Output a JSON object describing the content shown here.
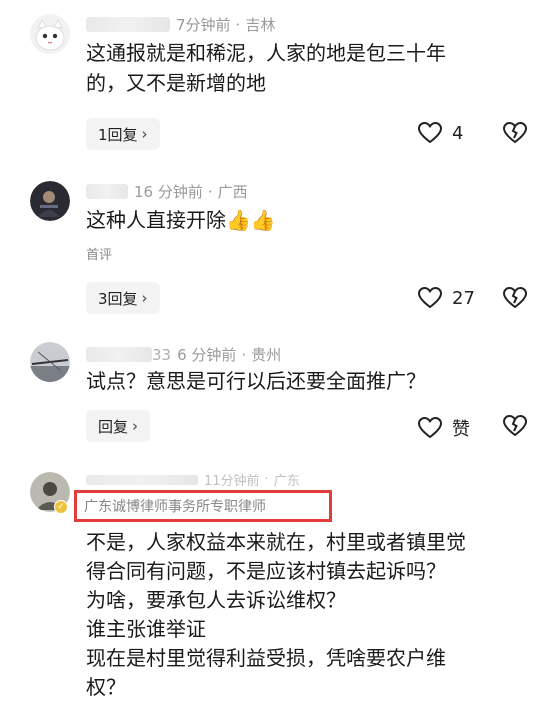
{
  "comments": [
    {
      "time": "7分钟前",
      "location": "吉林",
      "text_line1": "这通报就是和稀泥，人家的地是包三十年",
      "text_line2": "的，又不是新增的地",
      "reply_label": "1回复",
      "likes": "4"
    },
    {
      "time": "16 分钟前",
      "location": "广西",
      "text": "这种人直接开除👍👍",
      "tag": "首评",
      "reply_label": "3回复",
      "likes": "27"
    },
    {
      "name_suffix": "33",
      "time": "6 分钟前",
      "location": "贵州",
      "text": "试点？意思是可行以后还要全面推广？",
      "reply_label": "回复",
      "likes": "赞"
    },
    {
      "time": "11分钟前",
      "location": "广东",
      "lawyer_title": "广东诚博律师事务所专职律师",
      "lines": [
        "不是，人家权益本来就在，村里或者镇里觉",
        "得合同有问题，不是应该村镇去起诉吗？",
        "为啥，要承包人去诉讼维权？",
        "谁主张谁举证",
        "现在是村里觉得利益受损，凭啥要农户维",
        "权？"
      ]
    }
  ],
  "separator": "·",
  "colors": {
    "highlight_box": "#e43b3b",
    "meta_gray": "#9a9a9a",
    "reply_bg": "#f3f3f3"
  },
  "icons": [
    "heart-outline-icon",
    "broken-heart-icon",
    "chevron-right-icon",
    "verified-badge-icon"
  ]
}
